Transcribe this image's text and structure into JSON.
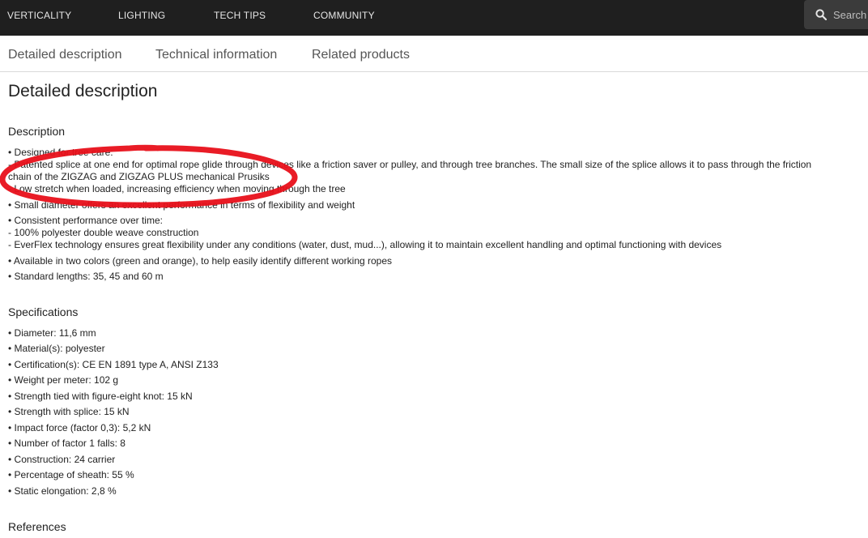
{
  "nav": {
    "items": [
      "VERTICALITY",
      "LIGHTING",
      "TECH TIPS",
      "COMMUNITY"
    ],
    "search_label": "Search"
  },
  "tabs": [
    "Detailed description",
    "Technical information",
    "Related products"
  ],
  "page_title": "Detailed description",
  "description": {
    "heading": "Description",
    "lines": [
      "• Designed for tree care:",
      "- Patented splice at one end for optimal rope glide through devices like a friction saver or pulley, and through tree branches. The small size of the splice allows it to pass through the friction",
      "chain of the ZIGZAG and ZIGZAG PLUS mechanical Prusiks",
      "- Low stretch when loaded, increasing efficiency when moving through the tree",
      "• Small diameter offers an excellent performance in terms of flexibility and weight",
      "• Consistent performance over time:",
      "- 100% polyester double weave construction",
      "- EverFlex technology ensures great flexibility under any conditions (water, dust, mud...), allowing it to maintain excellent handling and optimal functioning with devices",
      "• Available in two colors (green and orange), to help easily identify different working ropes",
      "• Standard lengths: 35, 45 and 60 m"
    ]
  },
  "specifications": {
    "heading": "Specifications",
    "lines": [
      "• Diameter: 11,6 mm",
      "• Material(s): polyester",
      "• Certification(s): CE EN 1891 type A, ANSI Z133",
      "• Weight per meter: 102 g",
      "• Strength tied with figure-eight knot: 15 kN",
      "• Strength with splice: 15 kN",
      "• Impact force (factor 0,3): 5,2 kN",
      "• Number of factor 1 falls: 8",
      "• Construction: 24 carrier",
      "• Percentage of sheath: 55 %",
      "• Static elongation: 2,8 %"
    ]
  },
  "references": {
    "heading": "References"
  },
  "colors": {
    "topbar": "#1f1f1f",
    "annotation": "#e8101a"
  },
  "icons": {
    "search": "search-icon"
  }
}
